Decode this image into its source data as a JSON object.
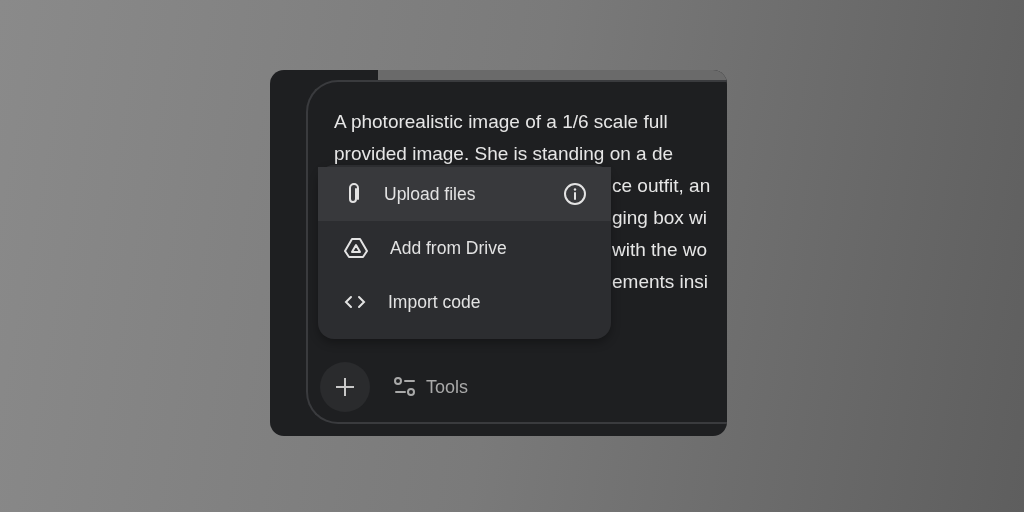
{
  "prompt": {
    "lines": [
      {
        "text": "A photorealistic image of a 1/6 scale full",
        "covered": false
      },
      {
        "text": "provided image. She is standing on a de",
        "covered": false
      },
      {
        "text": "ce outfit, an",
        "covered": true
      },
      {
        "text": "ging box wi",
        "covered": true
      },
      {
        "text": "with the wo",
        "covered": true
      },
      {
        "text": "ements insi",
        "covered": true
      }
    ]
  },
  "menu": {
    "items": [
      {
        "kind": "upload",
        "label": "Upload files",
        "selected": true,
        "info": true
      },
      {
        "kind": "drive",
        "label": "Add from Drive",
        "selected": false,
        "info": false
      },
      {
        "kind": "code",
        "label": "Import code",
        "selected": false,
        "info": false
      }
    ]
  },
  "toolbar": {
    "tools": "Tools"
  }
}
